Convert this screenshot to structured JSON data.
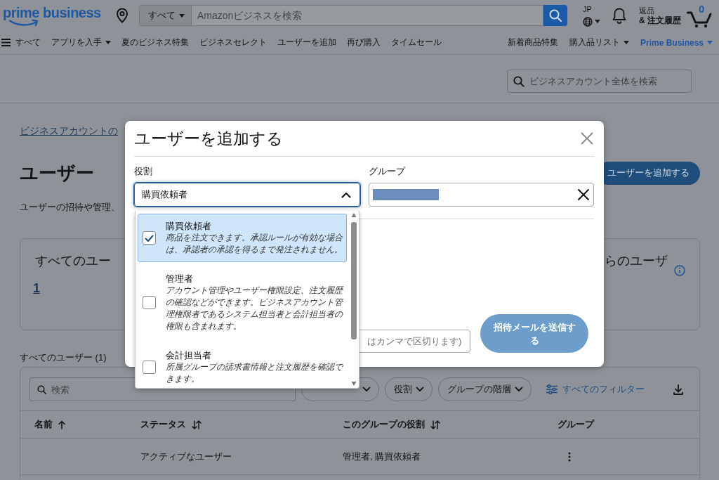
{
  "header": {
    "logo": "prime business",
    "search": {
      "category": "すべて",
      "placeholder": "Amazonビジネスを検索"
    },
    "locale": "JP",
    "orders": {
      "top": "返品",
      "bottom": "& 注文履歴"
    },
    "cart_count": "0"
  },
  "nav": {
    "menu_label": "すべて",
    "left_items": [
      {
        "label": "アプリを入手",
        "dropdown": true,
        "highlighted": false
      },
      {
        "label": "夏のビジネス特集",
        "dropdown": false,
        "highlighted": false
      },
      {
        "label": "ビジネスセレクト",
        "dropdown": false,
        "highlighted": false
      },
      {
        "label": "ユーザーを追加",
        "dropdown": false,
        "highlighted": false
      },
      {
        "label": "再び購入",
        "dropdown": false,
        "highlighted": false
      },
      {
        "label": "タイムセール",
        "dropdown": false,
        "highlighted": false
      }
    ],
    "right_items": [
      {
        "label": "新着商品特集",
        "dropdown": false,
        "highlighted": false
      },
      {
        "label": "購入品リスト",
        "dropdown": true,
        "highlighted": false
      },
      {
        "label": "Prime Business",
        "dropdown": true,
        "highlighted": true
      }
    ]
  },
  "account_search": {
    "placeholder": "ビジネスアカウント全体を検索"
  },
  "breadcrumb": "ビジネスアカウントの",
  "page": {
    "title": "ユーザー",
    "description": "ユーザーの招待や管理、",
    "add_button": "ユーザーを追加する"
  },
  "stats": [
    {
      "label": "すべてのユー",
      "value": "1",
      "info": false
    },
    {
      "label": "らのユーザ",
      "info": true
    }
  ],
  "users": {
    "heading": "すべてのユーザー (1)",
    "search_placeholder": "検索",
    "filters": [
      {
        "dropdown": true
      },
      {
        "label": "役割",
        "dropdown": true
      },
      {
        "label": "グループの階層",
        "dropdown": true
      }
    ],
    "all_filters": "すべてのフィルター",
    "columns": [
      {
        "label": "名前",
        "kind": "sorted"
      },
      {
        "label": "ステータス",
        "kind": "sortable"
      },
      {
        "label": "このグループの役割",
        "kind": "sortable"
      },
      {
        "label": "グループ",
        "kind": "plain"
      }
    ],
    "rows": [
      {
        "status": "アクティブなユーザー",
        "roles": "管理者, 購買依頼者"
      }
    ]
  },
  "modal": {
    "title": "ユーザーを追加する",
    "role": {
      "label": "役割",
      "value": "購買依頼者",
      "expanded": true,
      "options": [
        {
          "title": "購買依頼者",
          "description": "商品を注文できます。承認ルールが有効な場合は、承認者の承認を得るまで発注されません。",
          "checked": true,
          "selected": true
        },
        {
          "title": "管理者",
          "description": "アカウント管理やユーザー権限設定、注文履歴の確認などができます。ビジネスアカウント管理権限者であるシステム担当者と会計担当者の権限も含まれます。",
          "checked": false,
          "selected": false
        },
        {
          "title": "会計担当者",
          "description": "所属グループの請求書情報と注文履歴を確認できます。",
          "checked": false,
          "selected": false
        }
      ]
    },
    "group": {
      "label": "グループ",
      "value_redacted": true
    },
    "email": {
      "placeholder": "はカンマで区切ります)"
    },
    "send_button": {
      "label": "招待メールを送信する",
      "disabled": true
    }
  }
}
